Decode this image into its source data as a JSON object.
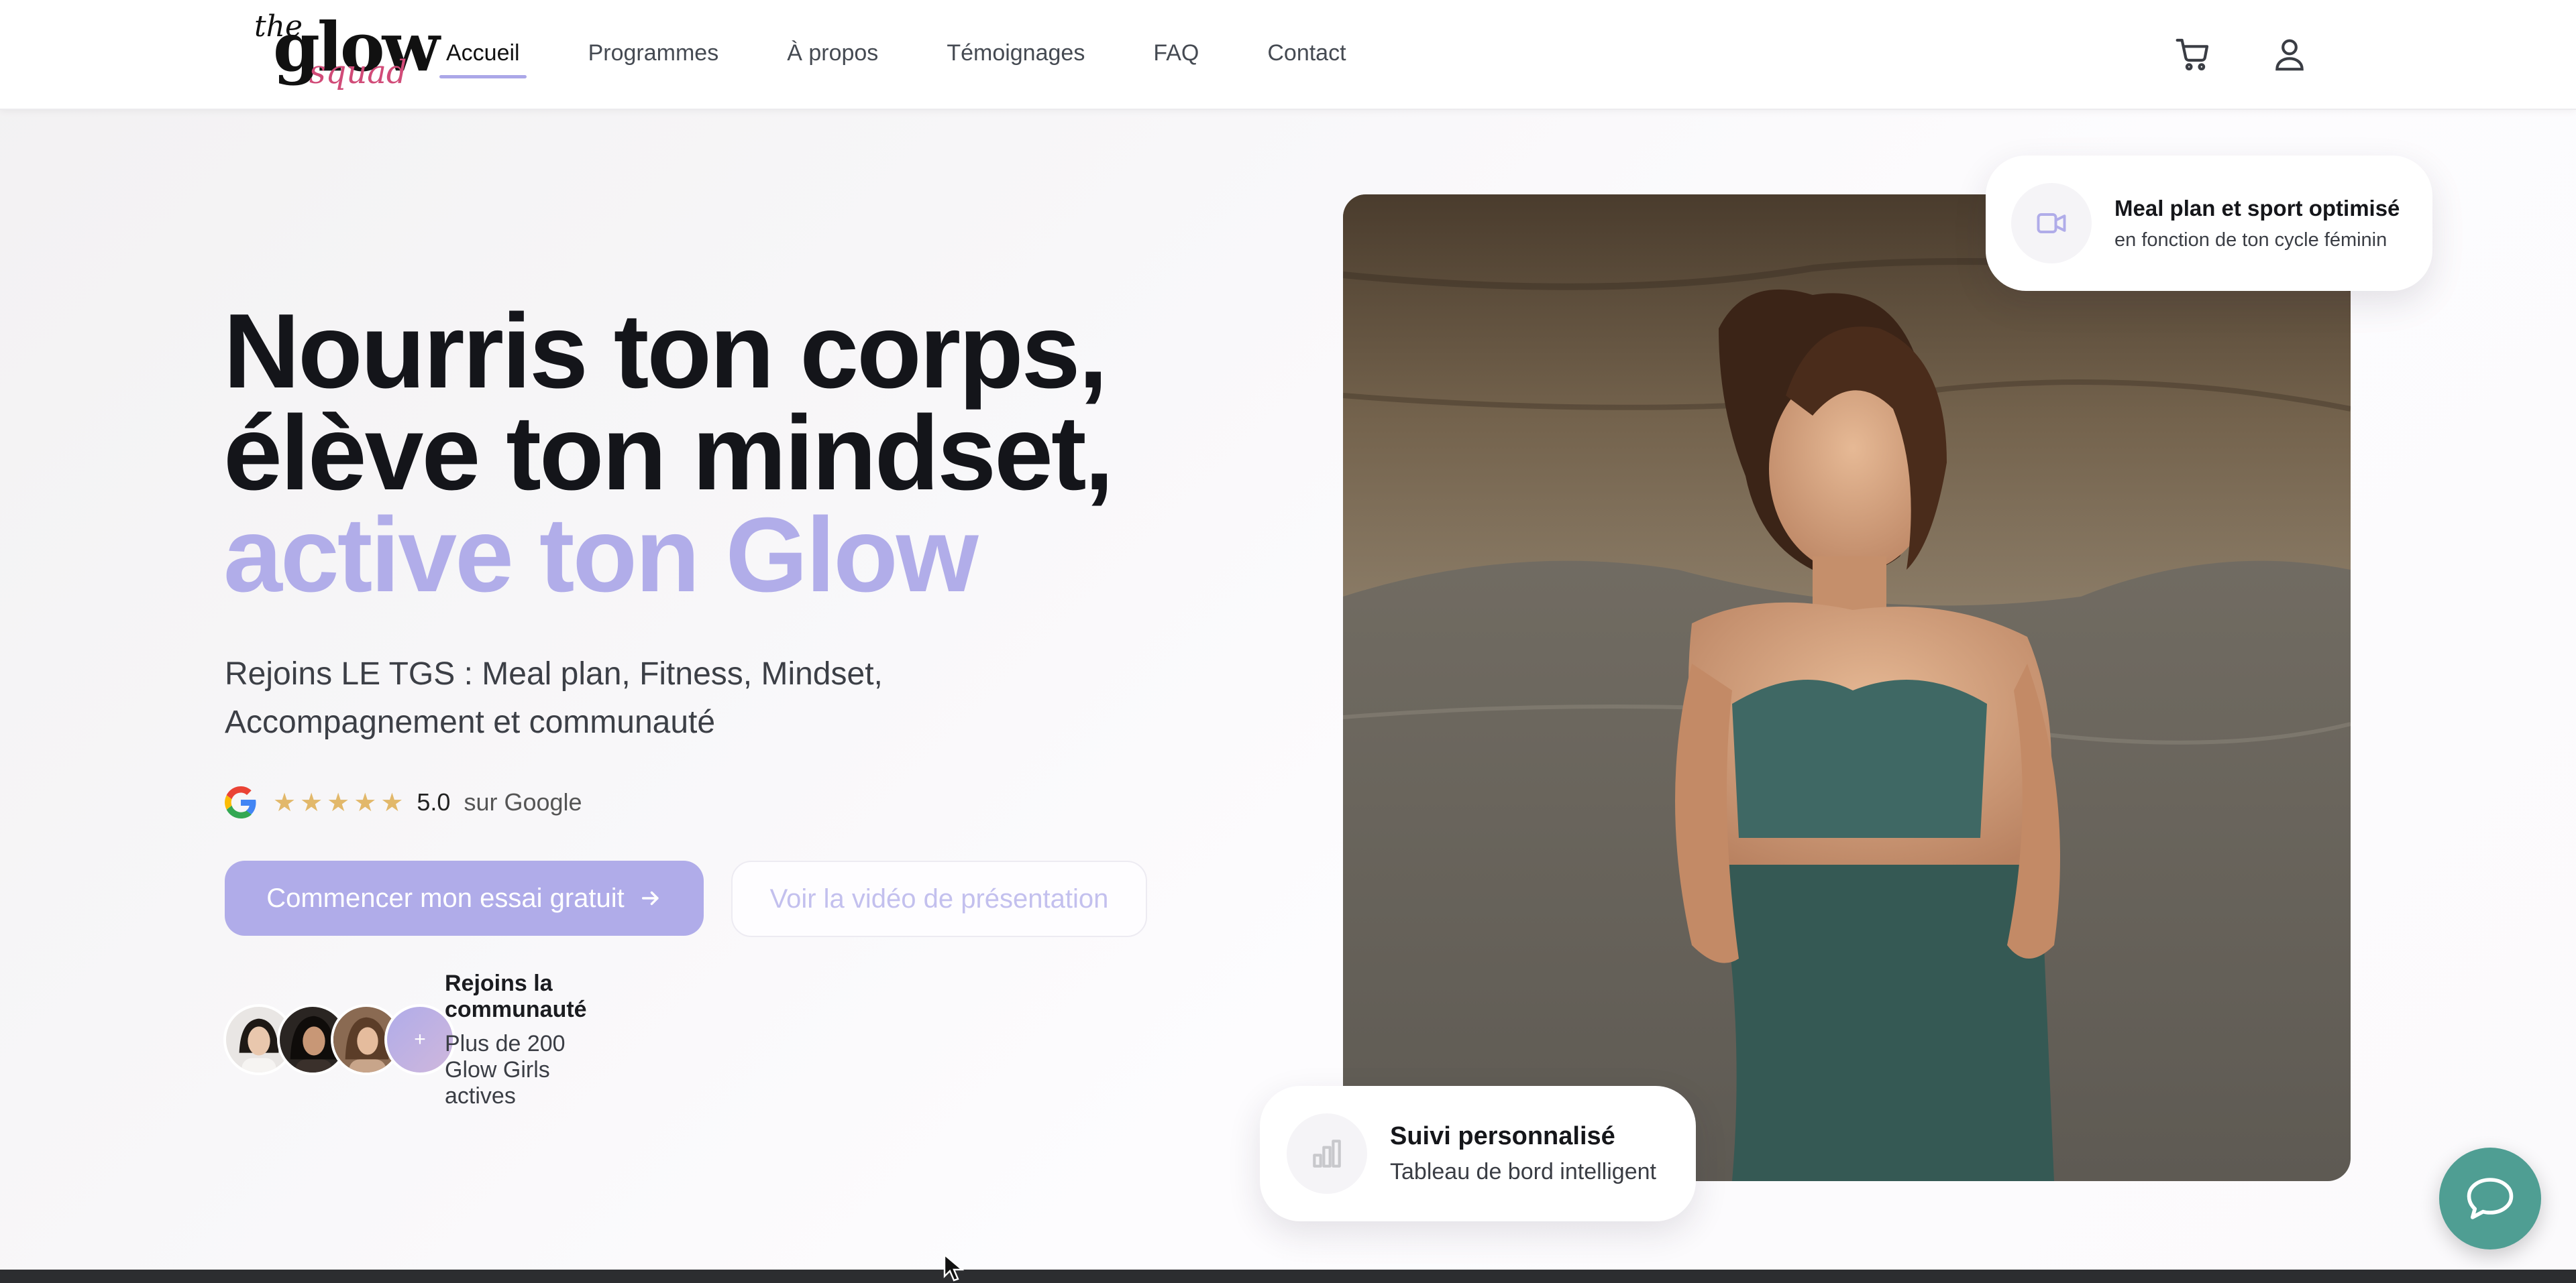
{
  "brand": {
    "logo_small": "the",
    "logo_main": "glow",
    "logo_script": "squad"
  },
  "nav": {
    "items": [
      {
        "label": "Accueil",
        "active": true
      },
      {
        "label": "Programmes",
        "active": false
      },
      {
        "label": "À propos",
        "active": false
      },
      {
        "label": "Témoignages",
        "active": false
      },
      {
        "label": "FAQ",
        "active": false
      },
      {
        "label": "Contact",
        "active": false
      }
    ],
    "icons": [
      "cart-icon",
      "user-icon"
    ]
  },
  "hero": {
    "title_line1": "Nourris ton corps,",
    "title_line2": "élève ton mindset,",
    "title_line3": "active ton Glow",
    "subtitle_line1": "Rejoins LE TGS : Meal plan, Fitness, Mindset,",
    "subtitle_line2": "Accompagnement et communauté",
    "rating": {
      "stars": 5,
      "score": "5.0",
      "source": "sur Google"
    },
    "cta_primary": "Commencer mon essai gratuit",
    "cta_secondary": "Voir la vidéo de présentation",
    "community": {
      "title": "Rejoins la communauté",
      "subtitle": "Plus de 200 Glow Girls actives",
      "more": "+"
    }
  },
  "cards": {
    "top": {
      "icon": "video-icon",
      "title": "Meal plan et sport optimisé",
      "subtitle": "en fonction de ton cycle féminin"
    },
    "bottom": {
      "icon": "bar-chart-icon",
      "title": "Suivi personnalisé",
      "subtitle": "Tableau de bord intelligent"
    }
  },
  "colors": {
    "accent": "#b0ace9",
    "title": "#14151a",
    "star": "#e2b86a",
    "chat": "#4f9e93"
  }
}
